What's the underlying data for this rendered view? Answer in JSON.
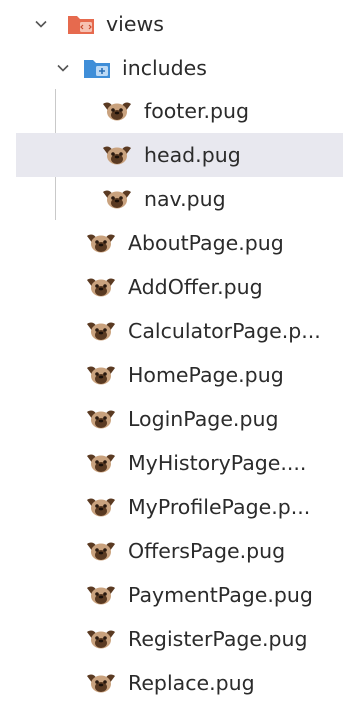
{
  "explorer": {
    "folders": {
      "views": {
        "name": "views",
        "expanded": true
      },
      "includes": {
        "name": "includes",
        "expanded": true
      }
    },
    "include_files": [
      {
        "name": "footer.pug",
        "selected": false
      },
      {
        "name": "head.pug",
        "selected": true
      },
      {
        "name": "nav.pug",
        "selected": false
      }
    ],
    "view_files": [
      {
        "name": "AboutPage.pug"
      },
      {
        "name": "AddOffer.pug"
      },
      {
        "name": "CalculatorPage.p..."
      },
      {
        "name": "HomePage.pug"
      },
      {
        "name": "LoginPage.pug"
      },
      {
        "name": "MyHistoryPage...."
      },
      {
        "name": "MyProfilePage.p..."
      },
      {
        "name": "OffersPage.pug"
      },
      {
        "name": "PaymentPage.pug"
      },
      {
        "name": "RegisterPage.pug"
      },
      {
        "name": "Replace.pug"
      }
    ],
    "icons": {
      "folder_views": "views-folder-icon",
      "folder_includes": "includes-folder-icon",
      "file": "pug-file-icon",
      "expand": "chevron-down-icon"
    },
    "colors": {
      "views_folder": "#e66a4e",
      "includes_folder": "#3f8ed8",
      "selected_bg": "#e8e8ef",
      "pug_brown": "#5a3a22",
      "pug_tan": "#c9a27e"
    }
  }
}
